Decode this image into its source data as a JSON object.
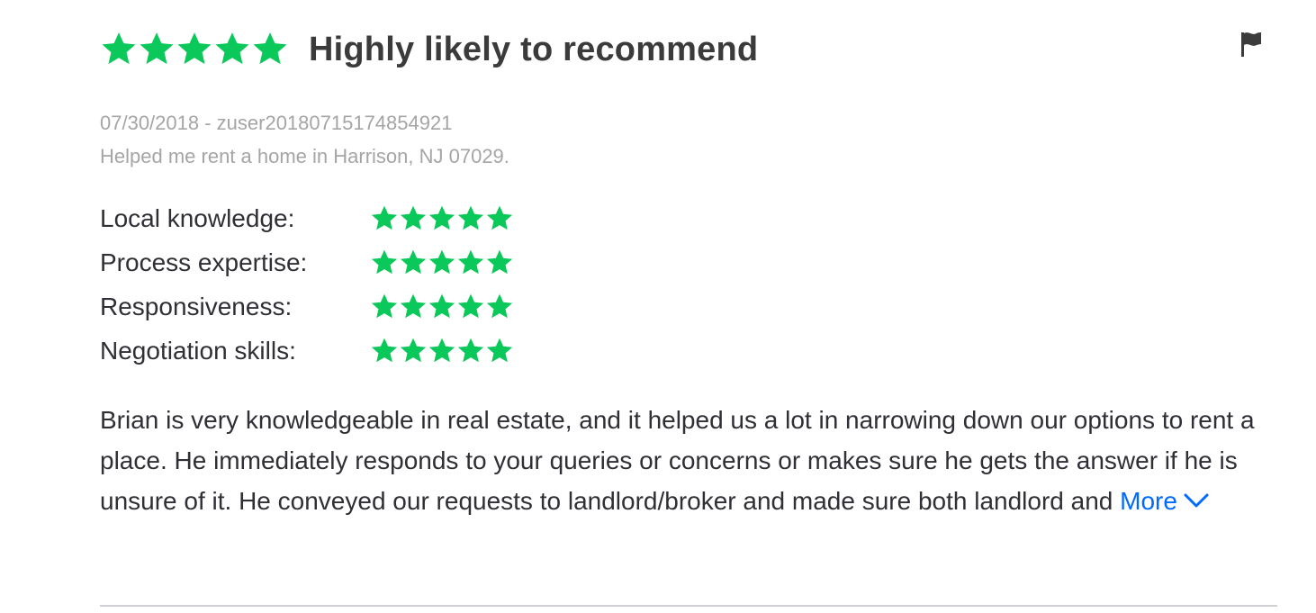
{
  "review": {
    "overall_rating": 5,
    "headline": "Highly likely to recommend",
    "date_user": "07/30/2018 - zuser20180715174854921",
    "helped_text": "Helped me rent a home in Harrison, NJ 07029.",
    "ratings": [
      {
        "label": "Local knowledge:",
        "stars": 5
      },
      {
        "label": "Process expertise:",
        "stars": 5
      },
      {
        "label": "Responsiveness:",
        "stars": 5
      },
      {
        "label": "Negotiation skills:",
        "stars": 5
      }
    ],
    "body": "Brian is very knowledgeable in real estate, and it helped us a lot in narrowing down our options to rent a place. He immediately responds to your queries or concerns or makes sure he gets the answer if he is unsure of it. He conveyed our requests to landlord/broker and made sure both landlord and",
    "more_label": "More"
  },
  "icons": {
    "star": "star-icon",
    "flag": "flag-icon",
    "chevron": "chevron-down-icon"
  },
  "colors": {
    "star": "#0ac85a",
    "link": "#006aff",
    "meta": "#a5a5a5"
  }
}
